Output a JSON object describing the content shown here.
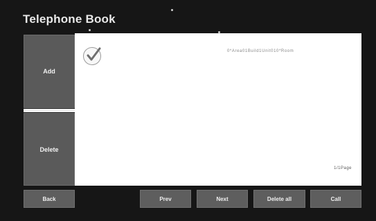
{
  "window": {
    "title": "Telephone Book"
  },
  "side": {
    "add_label": "Add",
    "delete_label": "Delete"
  },
  "list": {
    "entries": [
      {
        "text": "0*Area01Build1Unit010*Room",
        "checked": true
      }
    ],
    "page_indicator": "1/1Page"
  },
  "bottom": {
    "back_label": "Back",
    "prev_label": "Prev",
    "next_label": "Next",
    "delete_all_label": "Delete all",
    "call_label": "Call"
  },
  "colors": {
    "background": "#161616",
    "button": "#5a5a5a",
    "panel": "#ffffff"
  },
  "icons": {
    "entry_check": "checkmark-icon"
  }
}
